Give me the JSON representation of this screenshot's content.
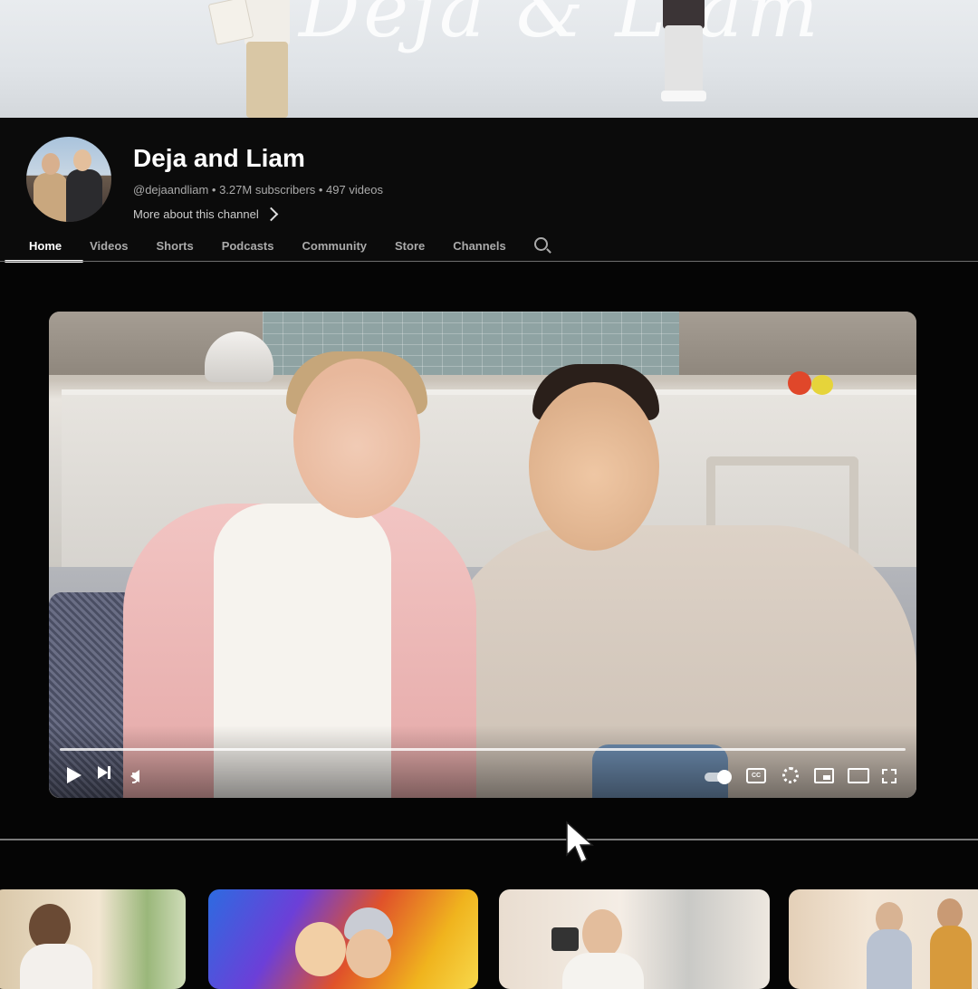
{
  "banner": {
    "script_title": "Deja & Liam"
  },
  "channel": {
    "name": "Deja and Liam",
    "handle_line": "@dejaandliam • 3.27M subscribers • 497 videos",
    "more_label": "More about this channel"
  },
  "tabs": [
    {
      "label": "Home",
      "active": true
    },
    {
      "label": "Videos",
      "active": false
    },
    {
      "label": "Shorts",
      "active": false
    },
    {
      "label": "Podcasts",
      "active": false
    },
    {
      "label": "Community",
      "active": false
    },
    {
      "label": "Store",
      "active": false
    },
    {
      "label": "Channels",
      "active": false
    }
  ],
  "icons": {
    "tab_search": "search-icon",
    "play": "play-icon",
    "next": "next-icon",
    "volume": "volume-icon",
    "autoplay": "autoplay-toggle-icon",
    "captions": "captions-icon",
    "settings": "gear-icon",
    "miniplayer": "miniplayer-icon",
    "theater": "theater-mode-icon",
    "fullscreen": "fullscreen-icon",
    "cursor": "mouse-pointer-icon"
  },
  "player": {
    "captions_label": "CC"
  },
  "colors": {
    "background": "#050505",
    "header": "#0b0b0b",
    "text_primary": "#ffffff",
    "text_secondary": "#aaaaaa"
  }
}
